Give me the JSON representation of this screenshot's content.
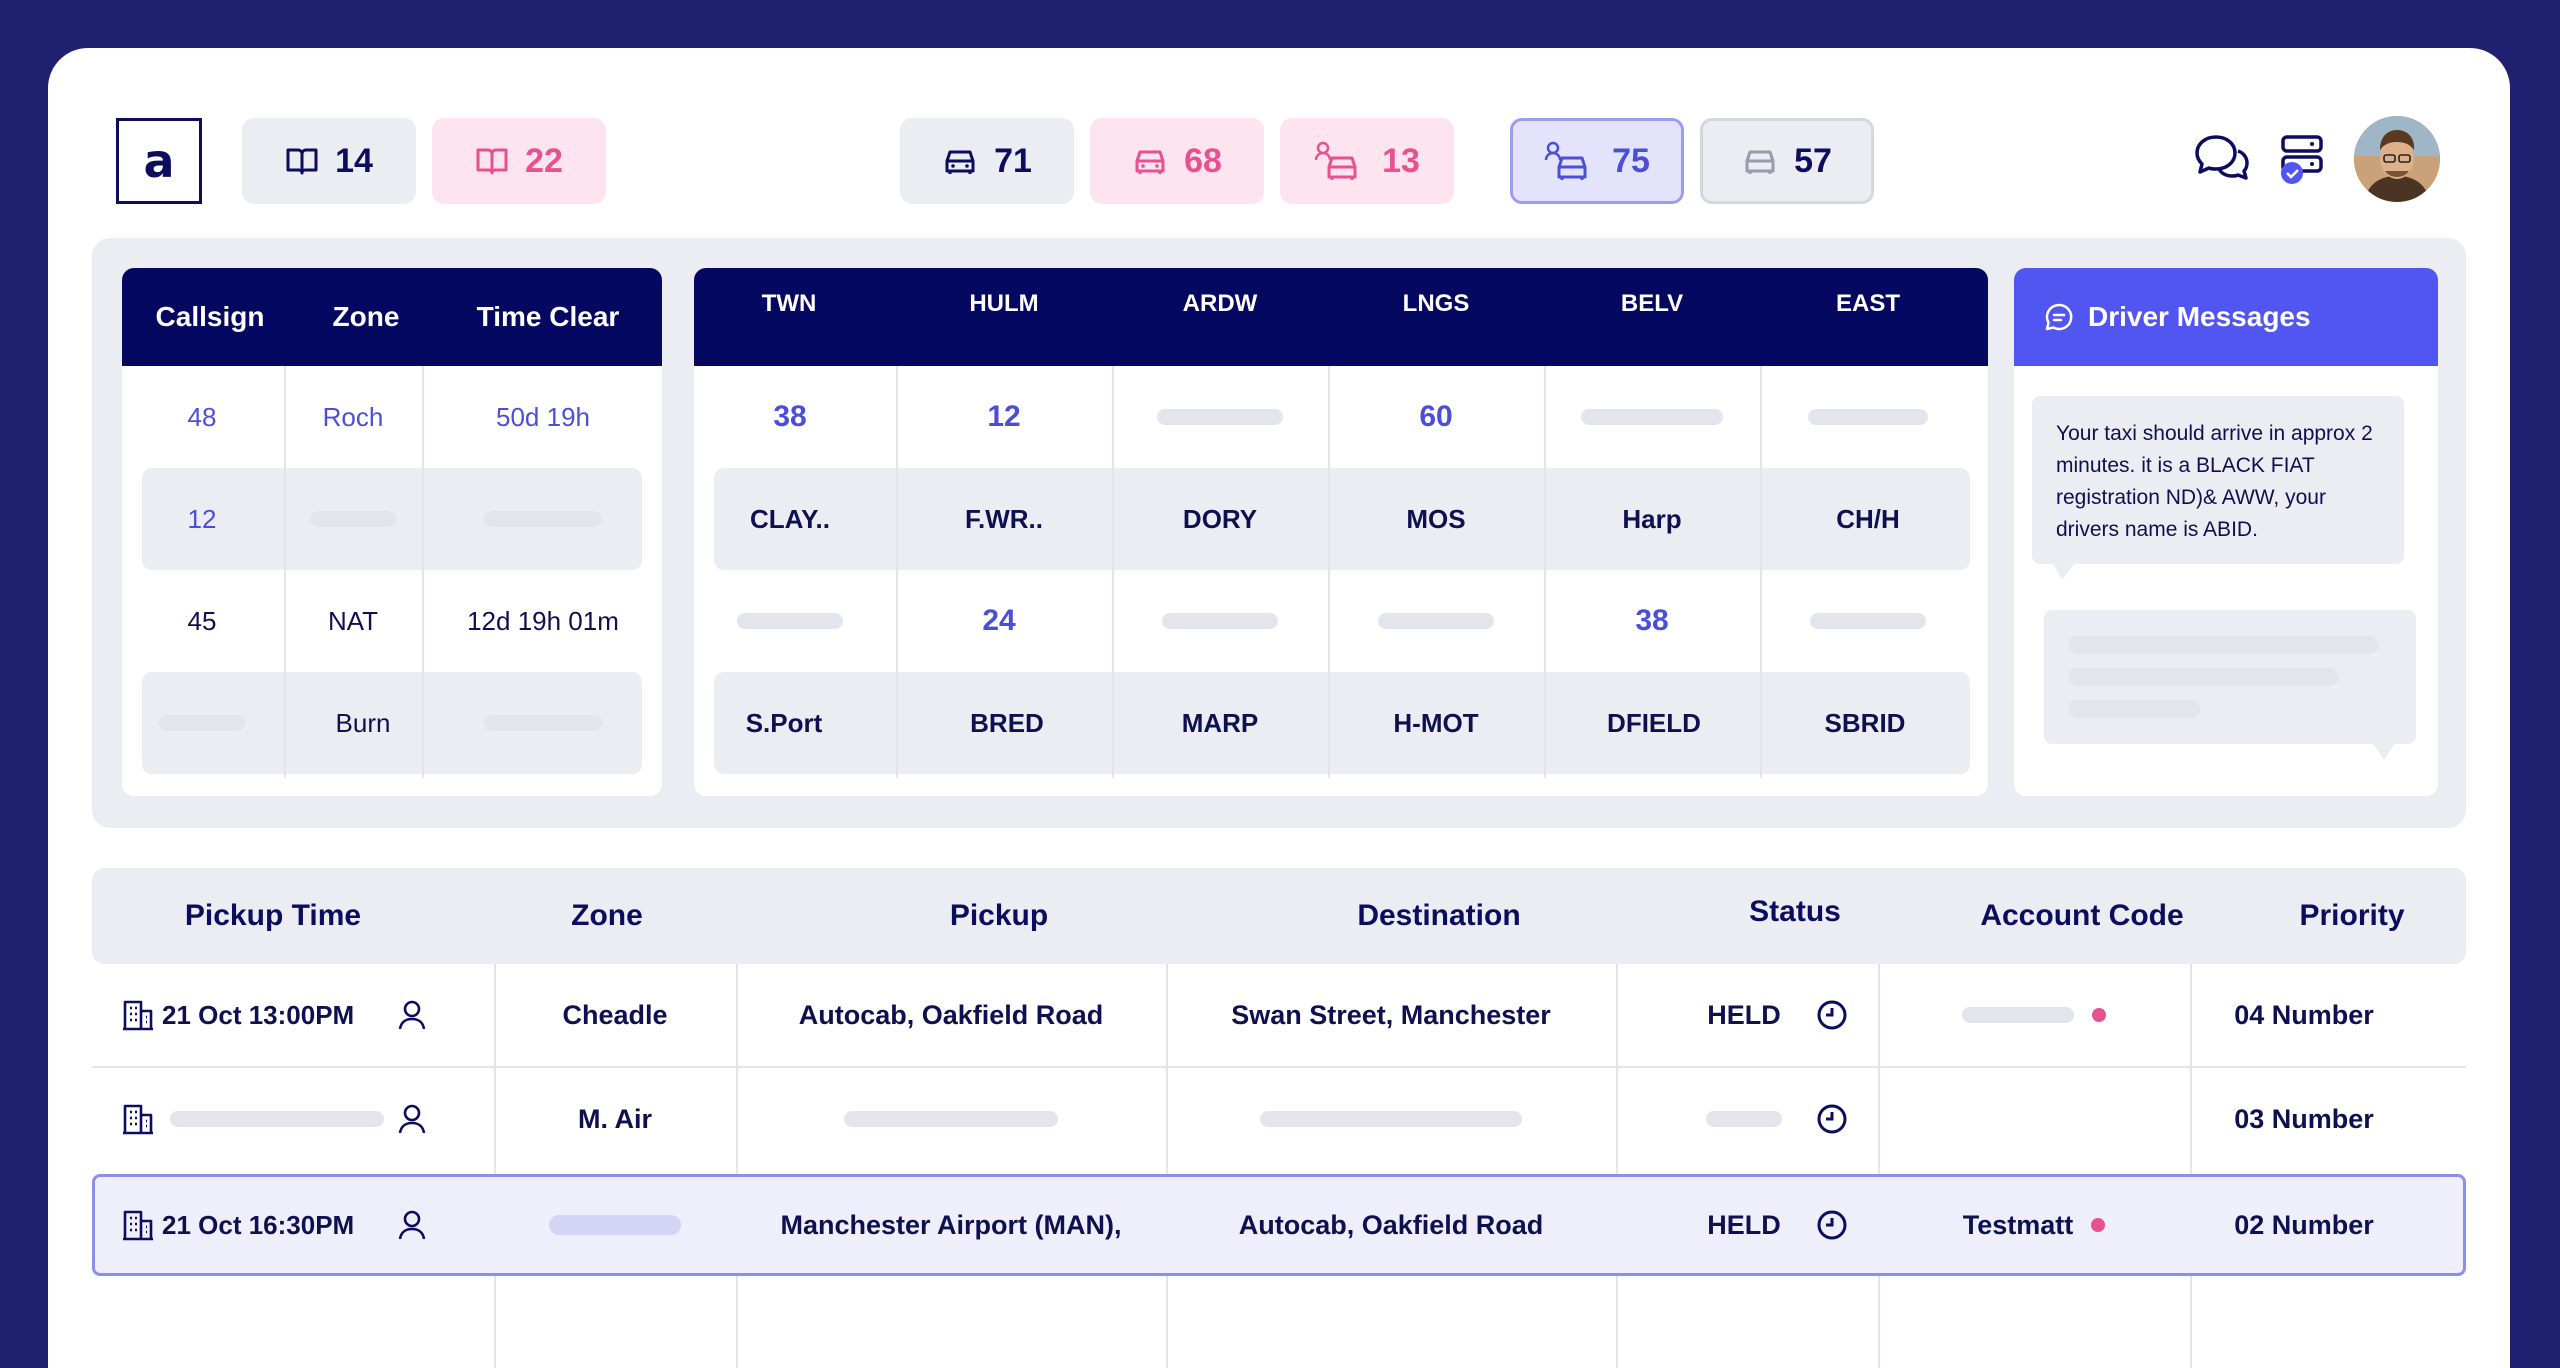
{
  "logo": "a",
  "stats": {
    "bookings_open": "14",
    "bookings_pending": "22",
    "cars_total": "71",
    "cars_busy": "68",
    "cars_driver_pending": "13",
    "cars_driver_active": "75",
    "cars_inactive": "57"
  },
  "colors": {
    "navy": "#050860",
    "accent_blue": "#4b4fd8",
    "pink": "#e8508f",
    "panel_grey": "#ececf3"
  },
  "callsign_card": {
    "headers": [
      "Callsign",
      "Zone",
      "Time Clear"
    ],
    "rows": [
      [
        "48",
        "Roch",
        "50d 19h"
      ],
      [
        "12",
        "",
        ""
      ],
      [
        "45",
        "NAT",
        "12d 19h 01m"
      ],
      [
        "",
        "Burn",
        ""
      ]
    ]
  },
  "zone_card": {
    "headers": [
      "TWN",
      "HULM",
      "ARDW",
      "LNGS",
      "BELV",
      "EAST"
    ],
    "rows": [
      [
        "38",
        "12",
        "",
        "60",
        "",
        ""
      ],
      [
        "CLAY..",
        "F.WR..",
        "DORY",
        "MOS",
        "Harp",
        "CH/H"
      ],
      [
        "",
        "24",
        "",
        "",
        "38",
        ""
      ],
      [
        "S.Port",
        "BRED",
        "MARP",
        "H-MOT",
        "DFIELD",
        "SBRID"
      ]
    ]
  },
  "driver_messages": {
    "title": "Driver Messages",
    "message": "Your taxi should arrive in approx 2 minutes. it is a BLACK FIAT registration ND)& AWW, your drivers name is ABID."
  },
  "jobs_table": {
    "headers": [
      "Pickup Time",
      "Zone",
      "Pickup",
      "Destination",
      "Status",
      "Account Code",
      "Priority"
    ],
    "rows": [
      {
        "pickup_time": "21 Oct 13:00PM",
        "zone": "Cheadle",
        "pickup": "Autocab, Oakfield Road",
        "destination": "Swan Street, Manchester",
        "status": "HELD",
        "account": "",
        "priority": "04 Number"
      },
      {
        "pickup_time": "",
        "zone": "M. Air",
        "pickup": "",
        "destination": "",
        "status": "",
        "account": "",
        "priority": "03 Number"
      },
      {
        "pickup_time": "21 Oct 16:30PM",
        "zone": "",
        "pickup": "Manchester Airport (MAN),",
        "destination": "Autocab, Oakfield Road",
        "status": "HELD",
        "account": "Testmatt",
        "priority": "02 Number"
      }
    ]
  }
}
